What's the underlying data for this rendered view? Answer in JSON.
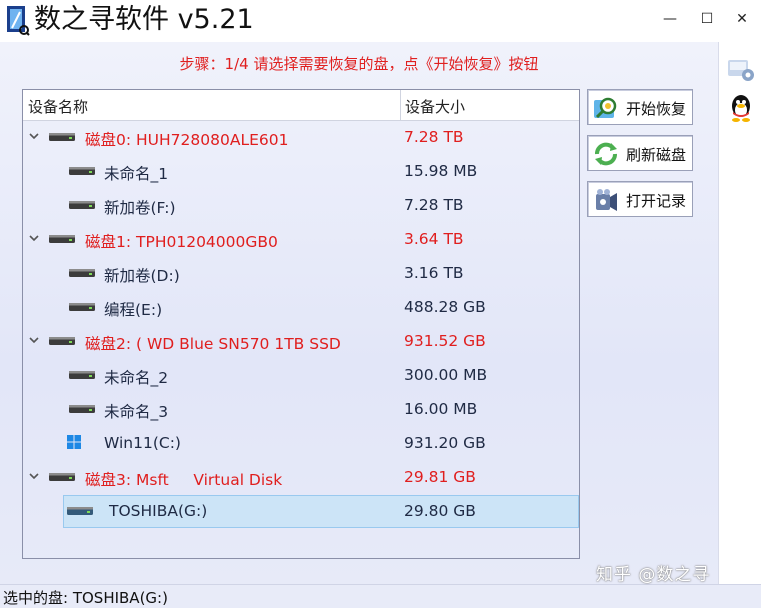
{
  "window": {
    "title": "数之寻软件 v5.21",
    "min_glyph": "—",
    "max_glyph": "☐",
    "close_glyph": "✕"
  },
  "steps_text": "步骤：1/4 请选择需要恢复的盘，点《开始恢复》按钮",
  "list": {
    "col_name": "设备名称",
    "col_size": "设备大小",
    "rows": [
      {
        "level": 0,
        "icon": "hard-disk-icon",
        "name": "磁盘0: HUH728080ALE601",
        "size": "7.28 TB",
        "color": "#e01e1e"
      },
      {
        "level": 1,
        "icon": "drive-icon",
        "name": "未命名_1",
        "size": "15.98 MB",
        "color": "#1f2a44"
      },
      {
        "level": 1,
        "icon": "drive-icon",
        "name": "新加卷(F:)",
        "size": "7.28 TB",
        "color": "#1f2a44"
      },
      {
        "level": 0,
        "icon": "hard-disk-icon",
        "name": "磁盘1: TPH01204000GB0",
        "size": "3.64 TB",
        "color": "#e01e1e"
      },
      {
        "level": 1,
        "icon": "drive-icon",
        "name": "新加卷(D:)",
        "size": "3.16 TB",
        "color": "#1f2a44"
      },
      {
        "level": 1,
        "icon": "drive-icon",
        "name": "编程(E:)",
        "size": "488.28 GB",
        "color": "#1f2a44"
      },
      {
        "level": 0,
        "icon": "hard-disk-icon",
        "name": "磁盘2: ( WD Blue SN570 1TB SSD",
        "size": "931.52 GB",
        "color": "#e01e1e"
      },
      {
        "level": 1,
        "icon": "drive-icon",
        "name": "未命名_2",
        "size": "300.00 MB",
        "color": "#1f2a44"
      },
      {
        "level": 1,
        "icon": "drive-icon",
        "name": "未命名_3",
        "size": "16.00 MB",
        "color": "#1f2a44"
      },
      {
        "level": 1,
        "icon": "windows-drive-icon",
        "name": "Win11(C:)",
        "size": "931.20 GB",
        "color": "#1f2a44"
      },
      {
        "level": 0,
        "icon": "hard-disk-icon",
        "name": "磁盘3: Msft     Virtual Disk",
        "size": "29.81 GB",
        "color": "#e01e1e"
      },
      {
        "level": 1,
        "icon": "usb-drive-icon",
        "name": "TOSHIBA(G:)",
        "size": "29.80 GB",
        "color": "#1f2a44",
        "selected": true
      }
    ]
  },
  "buttons": {
    "start_recovery": "开始恢复",
    "refresh_disks": "刷新磁盘",
    "open_records": "打开记录"
  },
  "status": {
    "selected_disk": "选中的盘: TOSHIBA(G:)"
  },
  "watermark": "知乎 @数之寻"
}
